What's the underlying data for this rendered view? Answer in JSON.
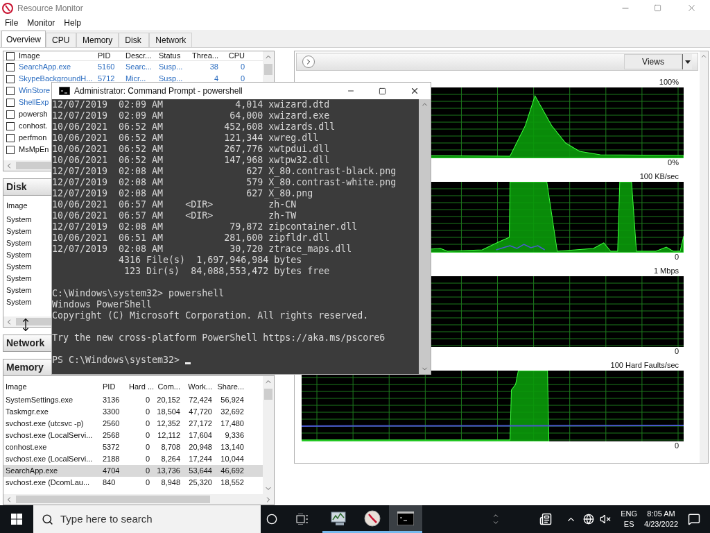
{
  "window": {
    "title": "Resource Monitor"
  },
  "menu": [
    "File",
    "Monitor",
    "Help"
  ],
  "tabs": [
    {
      "label": "Overview",
      "selected": true
    },
    {
      "label": "CPU",
      "selected": false
    },
    {
      "label": "Memory",
      "selected": false
    },
    {
      "label": "Disk",
      "selected": false
    },
    {
      "label": "Network",
      "selected": false
    }
  ],
  "cpu_table": {
    "all_checked": false,
    "columns": [
      "Image",
      "PID",
      "Descr...",
      "Status",
      "Threa...",
      "CPU"
    ],
    "rows": [
      {
        "cells": [
          "SearchApp.exe",
          "5160",
          "Searc...",
          "Susp...",
          "38",
          "0"
        ],
        "suspended": true,
        "checked": false
      },
      {
        "cells": [
          "SkypeBackgroundH...",
          "5712",
          "Micr...",
          "Susp...",
          "4",
          "0"
        ],
        "suspended": true,
        "checked": false
      },
      {
        "cells": [
          "WinStore"
        ],
        "suspended": true,
        "checked": false
      },
      {
        "cells": [
          "ShellExp"
        ],
        "suspended": true,
        "checked": false
      },
      {
        "cells": [
          "powersh"
        ],
        "suspended": false,
        "checked": false
      },
      {
        "cells": [
          "conhost."
        ],
        "suspended": false,
        "checked": false
      },
      {
        "cells": [
          "perfmon"
        ],
        "suspended": false,
        "checked": false
      },
      {
        "cells": [
          "MsMpEn"
        ],
        "suspended": false,
        "checked": false
      }
    ]
  },
  "disk": {
    "title": "Disk",
    "columns": [
      "Image"
    ],
    "rows": [
      "System",
      "System",
      "System",
      "System",
      "System",
      "System",
      "System",
      "System"
    ]
  },
  "network": {
    "title": "Network"
  },
  "memory": {
    "title": "Memory",
    "columns": [
      "Image",
      "PID",
      "Hard ...",
      "Com...",
      "Work...",
      "Share..."
    ],
    "rows": [
      {
        "cells": [
          "SystemSettings.exe",
          "3136",
          "0",
          "20,152",
          "72,424",
          "56,924"
        ],
        "selected": false
      },
      {
        "cells": [
          "Taskmgr.exe",
          "3300",
          "0",
          "18,504",
          "47,720",
          "32,692"
        ],
        "selected": false
      },
      {
        "cells": [
          "svchost.exe (utcsvc -p)",
          "2560",
          "0",
          "12,352",
          "27,172",
          "17,480"
        ],
        "selected": false
      },
      {
        "cells": [
          "svchost.exe (LocalServi...",
          "2568",
          "0",
          "12,112",
          "17,604",
          "9,336"
        ],
        "selected": false
      },
      {
        "cells": [
          "conhost.exe",
          "5372",
          "0",
          "8,708",
          "20,948",
          "13,140"
        ],
        "selected": false
      },
      {
        "cells": [
          "svchost.exe (LocalServi...",
          "2188",
          "0",
          "8,264",
          "17,244",
          "10,044"
        ],
        "selected": false
      },
      {
        "cells": [
          "SearchApp.exe",
          "4704",
          "0",
          "13,736",
          "53,644",
          "46,692"
        ],
        "selected": true
      },
      {
        "cells": [
          "svchost.exe (DcomLau...",
          "840",
          "0",
          "8,948",
          "25,320",
          "18,552"
        ],
        "selected": false
      }
    ]
  },
  "monitor_pane": {
    "views_button": "Views",
    "charts": [
      {
        "top_label": "100%",
        "bottom_label": "0%"
      },
      {
        "top_label": "100 KB/sec",
        "bottom_label": "0"
      },
      {
        "top_label": "1 Mbps",
        "bottom_label": "0"
      },
      {
        "top_label": "100 Hard Faults/sec",
        "bottom_label": "0"
      }
    ]
  },
  "console": {
    "title": "Administrator: Command Prompt - powershell",
    "cursor": true,
    "blocks": [
      [
        "12/07/2019  02:09 AM             4,014 xwizard.dtd",
        "12/07/2019  02:09 AM            64,000 xwizard.exe",
        "10/06/2021  06:52 AM           452,608 xwizards.dll",
        "10/06/2021  06:52 AM           121,344 xwreg.dll",
        "10/06/2021  06:52 AM           267,776 xwtpdui.dll",
        "10/06/2021  06:52 AM           147,968 xwtpw32.dll",
        "12/07/2019  02:08 AM               627 X_80.contrast-black.png",
        "12/07/2019  02:08 AM               579 X_80.contrast-white.png",
        "12/07/2019  02:08 AM               627 X_80.png",
        "10/06/2021  06:57 AM    <DIR>          zh-CN",
        "10/06/2021  06:57 AM    <DIR>          zh-TW",
        "12/07/2019  02:08 AM            79,872 zipcontainer.dll",
        "10/06/2021  06:51 AM           281,600 zipfldr.dll",
        "12/07/2019  02:08 AM            30,720 ztrace_maps.dll",
        "            4316 File(s)  1,697,946,984 bytes",
        "             123 Dir(s)  84,088,553,472 bytes free"
      ],
      [
        "C:\\Windows\\system32> powershell",
        "Windows PowerShell",
        "Copyright (C) Microsoft Corporation. All rights reserved."
      ],
      [
        "Try the new cross-platform PowerShell https://aka.ms/pscore6"
      ],
      [
        "PS C:\\Windows\\system32> "
      ]
    ]
  },
  "taskbar": {
    "search_placeholder": "Type here to search",
    "apps": [
      {
        "kind": "monitor",
        "selected": false
      },
      {
        "kind": "gauge",
        "selected": false
      },
      {
        "kind": "console",
        "selected": true
      }
    ],
    "language": "ENG",
    "layout": "ES",
    "time": "8:05 AM",
    "date": "4/23/2022"
  }
}
